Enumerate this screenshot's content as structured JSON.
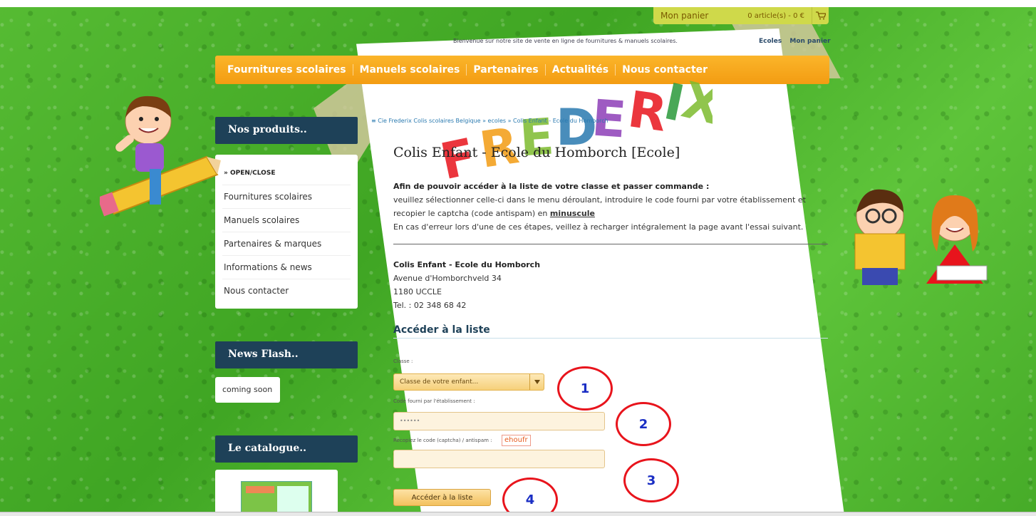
{
  "cart": {
    "label": "Mon panier",
    "count": "0 article(s) - 0 €"
  },
  "top": {
    "welcome": "Bienvenue sur notre site de vente en ligne de fournitures & manuels scolaires.",
    "links": [
      "Ecoles",
      "Mon panier"
    ]
  },
  "nav": [
    "Fournitures scolaires",
    "Manuels scolaires",
    "Partenaires",
    "Actualités",
    "Nous contacter"
  ],
  "sidebar": {
    "products_title": "Nos produits..",
    "menu": [
      "» OPEN/CLOSE",
      "Fournitures scolaires",
      "Manuels scolaires",
      "Partenaires & marques",
      "Informations & news",
      "Nous contacter"
    ],
    "news_title": "News Flash..",
    "news_text": "coming soon",
    "catalogue_title": "Le catalogue.."
  },
  "breadcrumb": "≡ Cie Frederix Colis scolaires Belgique » ecoles » Colis Enfant - Ecole du Homborch",
  "page_title": "Colis Enfant - Ecole du Homborch [Ecole]",
  "intro": {
    "heading": "Afin de pouvoir accéder à la liste de votre classe et passer commande :",
    "line1_pre": "veuillez sélectionner celle-ci dans le menu déroulant, introduire le code fourni par votre établissement et recopier le captcha (code antispam) en ",
    "line1_link": "minuscule",
    "line2": "En cas d'erreur lors d'une de ces étapes, veillez à recharger intégralement la page avant l'essai suivant."
  },
  "address": {
    "name": "Colis Enfant - Ecole du Homborch",
    "street": "Avenue d'Homborchveld 34",
    "city": "1180 UCCLE",
    "tel": "Tel. : 02 348 68 42"
  },
  "form": {
    "section_title": "Accéder à la liste",
    "class_label": "Classe :",
    "class_selected": "Classe de votre enfant...",
    "code_label": "Code fourni par l'établissement :",
    "code_value": "••••••",
    "captcha_label": "Recopiez le code (captcha) / antispam :",
    "captcha_code": "ehoufr",
    "captcha_value": "",
    "submit_label": "Accéder à la liste"
  },
  "markers": [
    "1",
    "2",
    "3",
    "4"
  ],
  "logo_text": "FREDERIX",
  "colors": {
    "nav": "#f39c12",
    "sidebar_head": "#1e4158",
    "marker": "#e8141c",
    "marker_text": "#1a2ec4"
  }
}
